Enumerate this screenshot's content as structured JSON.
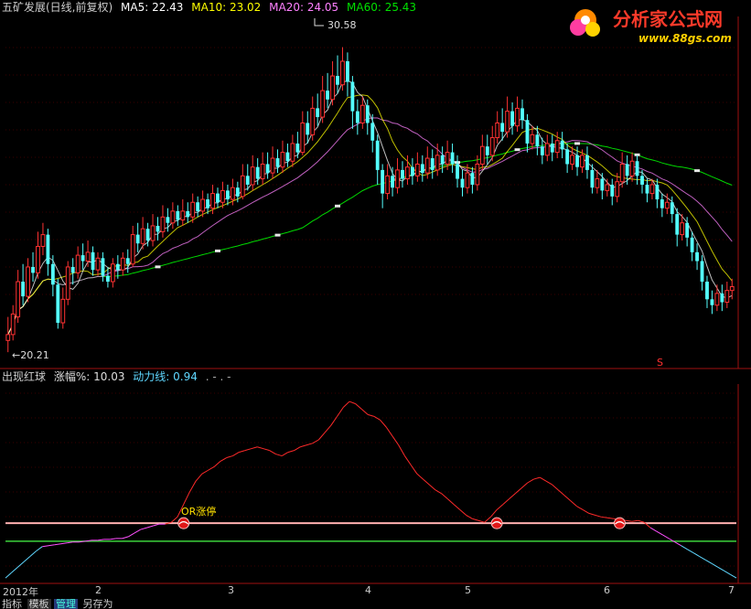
{
  "main_header": {
    "stock": "五矿发展(日线,前复权)",
    "ma5": "MA5: 22.43",
    "ma10": "MA10: 23.02",
    "ma20": "MA20: 24.05",
    "ma60": "MA60: 25.43"
  },
  "annotations": {
    "high_label": "30.58",
    "low_label": "←20.21",
    "s_marker": "S",
    "or_label": "OR涨停"
  },
  "sub_header": {
    "indicator": "出现红球",
    "change": "涨幅%: 10.03",
    "power": "动力线: 0.94",
    "dots": ". - . -"
  },
  "time_axis": [
    "2012年",
    "2",
    "3",
    "4",
    "5",
    "6",
    "7"
  ],
  "bottom_tabs": [
    "指标",
    "模板",
    "管理",
    "另存为"
  ],
  "logo": {
    "name": "分析家公式网",
    "url": "www.88gs.com"
  },
  "colors": {
    "up": "#ff3232",
    "down": "#54ffff",
    "ma5": "#ffffff",
    "ma10": "#ffff00",
    "ma20": "#ff80ff",
    "ma60": "#00ff00",
    "power_line": "#ff2a2a",
    "power_low": "#ff50ff",
    "power_base": "#5fd7ff"
  },
  "chart_data": {
    "type": "candlestick",
    "price_range": [
      19.8,
      31.5
    ],
    "ma5_last": 22.43,
    "ma10_last": 23.02,
    "ma20_last": 24.05,
    "ma60_last": 25.43,
    "high": 30.58,
    "low": 20.21,
    "candles": [
      [
        20.6,
        20.8,
        20.2,
        21.4
      ],
      [
        20.8,
        21.5,
        20.6,
        21.8
      ],
      [
        21.4,
        22.6,
        21.2,
        23.0
      ],
      [
        22.6,
        22.1,
        21.8,
        23.2
      ],
      [
        22.1,
        23.1,
        21.9,
        23.4
      ],
      [
        23.1,
        22.9,
        22.6,
        23.6
      ],
      [
        22.9,
        23.8,
        22.7,
        24.3
      ],
      [
        23.8,
        24.2,
        23.5,
        24.6
      ],
      [
        24.2,
        23.2,
        22.8,
        24.4
      ],
      [
        23.2,
        22.5,
        22.1,
        23.5
      ],
      [
        22.5,
        21.2,
        21.0,
        22.7
      ],
      [
        21.2,
        22.0,
        21.0,
        22.4
      ],
      [
        22.0,
        23.1,
        21.8,
        23.3
      ],
      [
        23.1,
        22.9,
        22.5,
        23.4
      ],
      [
        22.9,
        23.5,
        22.7,
        23.8
      ],
      [
        23.5,
        23.3,
        23.0,
        23.9
      ],
      [
        23.3,
        23.6,
        23.1,
        24.0
      ],
      [
        23.6,
        23.0,
        22.8,
        23.8
      ],
      [
        23.0,
        23.4,
        22.8,
        23.6
      ],
      [
        23.4,
        22.8,
        22.6,
        23.6
      ],
      [
        22.8,
        22.6,
        22.4,
        23.1
      ],
      [
        22.6,
        23.2,
        22.4,
        23.4
      ],
      [
        23.2,
        23.0,
        22.7,
        23.5
      ],
      [
        23.0,
        23.4,
        22.8,
        23.6
      ],
      [
        23.4,
        23.2,
        22.9,
        23.7
      ],
      [
        23.2,
        24.2,
        23.1,
        24.5
      ],
      [
        24.2,
        23.9,
        23.6,
        24.6
      ],
      [
        23.9,
        24.4,
        23.7,
        24.8
      ],
      [
        24.4,
        24.0,
        23.8,
        24.6
      ],
      [
        24.0,
        24.5,
        23.8,
        24.9
      ],
      [
        24.5,
        24.3,
        24.0,
        24.8
      ],
      [
        24.3,
        24.8,
        24.1,
        25.2
      ],
      [
        24.8,
        24.6,
        24.3,
        25.1
      ],
      [
        24.6,
        25.0,
        24.4,
        25.3
      ],
      [
        25.0,
        24.7,
        24.5,
        25.2
      ],
      [
        24.7,
        25.0,
        24.5,
        25.4
      ],
      [
        25.0,
        24.8,
        24.6,
        25.3
      ],
      [
        24.8,
        25.3,
        24.6,
        25.6
      ],
      [
        25.3,
        25.0,
        24.8,
        25.5
      ],
      [
        25.0,
        25.4,
        24.8,
        25.7
      ],
      [
        25.4,
        25.1,
        24.9,
        25.6
      ],
      [
        25.1,
        25.6,
        24.9,
        25.9
      ],
      [
        25.6,
        25.3,
        25.1,
        25.8
      ],
      [
        25.3,
        25.7,
        25.1,
        26.0
      ],
      [
        25.7,
        25.4,
        25.2,
        25.9
      ],
      [
        25.4,
        25.8,
        25.2,
        26.1
      ],
      [
        25.8,
        25.5,
        25.3,
        26.0
      ],
      [
        25.5,
        26.2,
        25.4,
        26.6
      ],
      [
        26.2,
        25.9,
        25.7,
        26.6
      ],
      [
        25.9,
        26.5,
        25.7,
        26.9
      ],
      [
        26.5,
        26.1,
        25.9,
        26.8
      ],
      [
        26.1,
        26.6,
        25.9,
        27.0
      ],
      [
        26.6,
        26.3,
        26.1,
        27.0
      ],
      [
        26.3,
        26.8,
        26.1,
        27.2
      ],
      [
        26.8,
        26.5,
        26.3,
        27.1
      ],
      [
        26.5,
        27.0,
        26.3,
        27.4
      ],
      [
        27.0,
        26.7,
        26.5,
        27.3
      ],
      [
        26.7,
        27.3,
        26.5,
        27.6
      ],
      [
        27.3,
        27.0,
        26.8,
        27.7
      ],
      [
        27.0,
        28.0,
        26.9,
        28.4
      ],
      [
        28.0,
        27.6,
        27.3,
        28.4
      ],
      [
        27.6,
        28.5,
        27.4,
        28.9
      ],
      [
        28.5,
        28.2,
        27.9,
        29.0
      ],
      [
        28.2,
        29.1,
        28.0,
        29.6
      ],
      [
        29.1,
        28.8,
        28.5,
        29.7
      ],
      [
        28.8,
        29.6,
        28.6,
        30.1
      ],
      [
        29.6,
        29.3,
        29.0,
        30.3
      ],
      [
        29.3,
        30.1,
        29.1,
        30.58
      ],
      [
        30.1,
        29.4,
        28.9,
        30.4
      ],
      [
        29.4,
        28.4,
        27.8,
        29.6
      ],
      [
        28.4,
        28.0,
        27.6,
        28.8
      ],
      [
        28.0,
        28.6,
        27.8,
        28.9
      ],
      [
        28.6,
        28.0,
        27.6,
        28.8
      ],
      [
        28.0,
        27.4,
        27.0,
        28.3
      ],
      [
        27.4,
        26.4,
        25.9,
        27.6
      ],
      [
        26.4,
        25.6,
        25.1,
        26.6
      ],
      [
        25.6,
        26.2,
        25.4,
        26.6
      ],
      [
        26.2,
        25.8,
        25.5,
        26.5
      ],
      [
        25.8,
        26.4,
        25.6,
        26.8
      ],
      [
        26.4,
        26.1,
        25.8,
        26.7
      ],
      [
        26.1,
        26.5,
        25.9,
        26.9
      ],
      [
        26.5,
        26.2,
        25.9,
        26.8
      ],
      [
        26.2,
        26.6,
        26.0,
        27.0
      ],
      [
        26.6,
        26.3,
        26.0,
        26.9
      ],
      [
        26.3,
        26.8,
        26.1,
        27.2
      ],
      [
        26.8,
        26.4,
        26.1,
        27.1
      ],
      [
        26.4,
        26.9,
        26.2,
        27.3
      ],
      [
        26.9,
        26.6,
        26.3,
        27.2
      ],
      [
        26.6,
        27.0,
        26.4,
        27.4
      ],
      [
        27.0,
        26.6,
        26.3,
        27.3
      ],
      [
        26.6,
        26.1,
        25.8,
        26.9
      ],
      [
        26.1,
        25.8,
        25.5,
        26.4
      ],
      [
        25.8,
        26.3,
        25.6,
        26.6
      ],
      [
        26.3,
        25.9,
        25.6,
        26.5
      ],
      [
        25.9,
        26.6,
        25.7,
        26.9
      ],
      [
        26.6,
        27.2,
        26.4,
        27.6
      ],
      [
        27.2,
        26.9,
        26.6,
        27.6
      ],
      [
        26.9,
        27.5,
        26.7,
        27.9
      ],
      [
        27.5,
        28.0,
        27.3,
        28.4
      ],
      [
        28.0,
        27.7,
        27.4,
        28.5
      ],
      [
        27.7,
        28.4,
        27.5,
        28.9
      ],
      [
        28.4,
        27.9,
        27.6,
        28.7
      ],
      [
        27.9,
        28.5,
        27.7,
        28.9
      ],
      [
        28.5,
        28.1,
        27.8,
        28.8
      ],
      [
        28.1,
        27.3,
        27.0,
        28.3
      ],
      [
        27.3,
        27.6,
        27.1,
        27.9
      ],
      [
        27.6,
        27.2,
        26.9,
        27.9
      ],
      [
        27.2,
        26.9,
        26.6,
        27.5
      ],
      [
        26.9,
        27.3,
        26.7,
        27.6
      ],
      [
        27.3,
        27.0,
        26.7,
        27.6
      ],
      [
        27.0,
        27.4,
        26.8,
        27.7
      ],
      [
        27.4,
        27.1,
        26.8,
        27.7
      ],
      [
        27.1,
        26.6,
        26.3,
        27.3
      ],
      [
        26.6,
        26.9,
        26.4,
        27.2
      ],
      [
        26.9,
        26.5,
        26.2,
        27.2
      ],
      [
        26.5,
        26.9,
        26.3,
        27.1
      ],
      [
        26.9,
        26.4,
        26.1,
        27.2
      ],
      [
        26.4,
        25.8,
        25.6,
        26.6
      ],
      [
        25.8,
        26.1,
        25.6,
        26.4
      ],
      [
        26.1,
        25.7,
        25.4,
        26.3
      ],
      [
        25.7,
        25.9,
        25.5,
        26.1
      ],
      [
        25.9,
        25.5,
        25.2,
        26.1
      ],
      [
        25.5,
        26.0,
        25.3,
        26.3
      ],
      [
        26.0,
        26.6,
        25.8,
        27.0
      ],
      [
        26.6,
        26.2,
        25.9,
        26.9
      ],
      [
        26.2,
        26.7,
        26.0,
        27.0
      ],
      [
        26.7,
        26.2,
        25.9,
        26.9
      ],
      [
        26.2,
        25.9,
        25.6,
        26.4
      ],
      [
        25.9,
        25.6,
        25.3,
        26.1
      ],
      [
        25.6,
        25.9,
        25.4,
        26.1
      ],
      [
        25.9,
        25.4,
        25.1,
        26.1
      ],
      [
        25.4,
        25.1,
        24.8,
        25.6
      ],
      [
        25.1,
        25.3,
        24.9,
        25.6
      ],
      [
        25.3,
        24.9,
        24.6,
        25.5
      ],
      [
        24.9,
        24.2,
        23.8,
        25.1
      ],
      [
        24.2,
        24.6,
        24.0,
        24.9
      ],
      [
        24.6,
        24.1,
        23.8,
        24.8
      ],
      [
        24.1,
        23.6,
        23.3,
        24.3
      ],
      [
        23.6,
        23.3,
        23.0,
        23.9
      ],
      [
        23.3,
        22.6,
        22.3,
        23.5
      ],
      [
        22.6,
        22.0,
        21.7,
        22.8
      ],
      [
        22.0,
        21.8,
        21.5,
        22.3
      ],
      [
        21.8,
        22.2,
        21.6,
        22.5
      ],
      [
        22.2,
        21.9,
        21.6,
        22.5
      ],
      [
        21.9,
        22.3,
        21.7,
        22.6
      ],
      [
        22.3,
        22.43,
        22.0,
        22.7
      ]
    ],
    "power_line": [
      0.2,
      0.5,
      0.8,
      1.1,
      1.4,
      1.7,
      1.95,
      2.0,
      2.05,
      2.1,
      2.15,
      2.2,
      2.2,
      2.25,
      2.3,
      2.3,
      2.35,
      2.35,
      2.4,
      2.4,
      2.5,
      2.7,
      2.9,
      3.0,
      3.1,
      3.2,
      3.2,
      3.3,
      3.6,
      4.3,
      5.0,
      5.6,
      6.0,
      6.2,
      6.4,
      6.7,
      6.9,
      7.0,
      7.2,
      7.3,
      7.4,
      7.5,
      7.4,
      7.3,
      7.1,
      7.0,
      7.2,
      7.3,
      7.5,
      7.6,
      7.7,
      7.9,
      8.3,
      8.7,
      9.2,
      9.7,
      10.03,
      9.9,
      9.6,
      9.3,
      9.2,
      9.0,
      8.6,
      8.1,
      7.6,
      7.0,
      6.5,
      6.0,
      5.7,
      5.4,
      5.1,
      4.9,
      4.6,
      4.3,
      4.0,
      3.7,
      3.5,
      3.4,
      3.3,
      3.6,
      4.0,
      4.3,
      4.6,
      4.9,
      5.2,
      5.5,
      5.7,
      5.8,
      5.6,
      5.4,
      5.1,
      4.8,
      4.5,
      4.2,
      4.0,
      3.8,
      3.7,
      3.6,
      3.55,
      3.5,
      3.45,
      3.4,
      3.35,
      3.4,
      3.3,
      3.0,
      2.8,
      2.6,
      2.4,
      2.2,
      2.0,
      1.8,
      1.6,
      1.4,
      1.2,
      1.0,
      0.8,
      0.6,
      0.4,
      0.2
    ],
    "power_range": [
      0,
      11
    ],
    "threshold_upper": 3.25,
    "threshold_lower": 2.25,
    "red_balls_at": [
      29,
      80,
      100
    ]
  }
}
